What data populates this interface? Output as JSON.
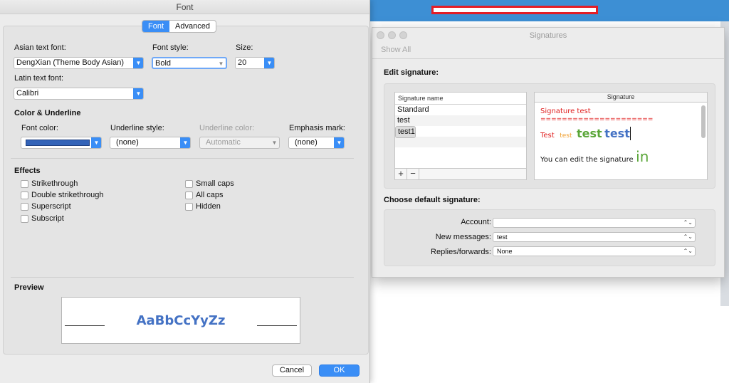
{
  "colors": {
    "accent": "#3a8ef6",
    "font_color_swatch": "#3363b8",
    "sig_red": "#e02020",
    "sig_orange": "#f0a030",
    "sig_green": "#5aa638",
    "sig_blue": "#4472c4",
    "preview_text": "#4472c4"
  },
  "font_dialog": {
    "title": "Font",
    "tabs": [
      {
        "label": "Font",
        "active": true
      },
      {
        "label": "Advanced",
        "active": false
      }
    ],
    "asian_font": {
      "label": "Asian text font:",
      "value": "DengXian (Theme Body Asian)"
    },
    "font_style": {
      "label": "Font style:",
      "value": "Bold"
    },
    "size": {
      "label": "Size:",
      "value": "20"
    },
    "latin_font": {
      "label": "Latin text font:",
      "value": "Calibri"
    },
    "color_section": {
      "title": "Color & Underline",
      "font_color_label": "Font color:",
      "underline_style_label": "Underline style:",
      "underline_style_value": "(none)",
      "underline_color_label": "Underline color:",
      "underline_color_value": "Automatic",
      "emphasis_label": "Emphasis mark:",
      "emphasis_value": "(none)"
    },
    "effects": {
      "title": "Effects",
      "left": [
        "Strikethrough",
        "Double strikethrough",
        "Superscript",
        "Subscript"
      ],
      "right": [
        "Small caps",
        "All caps",
        "Hidden"
      ]
    },
    "preview": {
      "title": "Preview",
      "sample": "AaBbCcYyZz"
    },
    "buttons": {
      "cancel": "Cancel",
      "ok": "OK"
    }
  },
  "signatures_window": {
    "title": "Signatures",
    "show_all": "Show All",
    "edit_label": "Edit signature:",
    "list_header": "Signature name",
    "signatures": [
      "Standard",
      "test",
      "test1"
    ],
    "selected_index": 2,
    "preview_header": "Signature",
    "preview": {
      "line1": "Signature test",
      "line2": "=====================",
      "word1": "Test",
      "word2": "test",
      "word3": "test",
      "word4": "test",
      "line4_text": "You can edit the signature",
      "line4_big": "in"
    },
    "default_label": "Choose default signature:",
    "account": {
      "label": "Account:",
      "value": ""
    },
    "new_messages": {
      "label": "New messages:",
      "value": "test"
    },
    "replies": {
      "label": "Replies/forwards:",
      "value": "None"
    }
  },
  "icons": {
    "plus": "+",
    "minus": "−",
    "dropdown": "▼",
    "updown": "⌃⌄"
  }
}
